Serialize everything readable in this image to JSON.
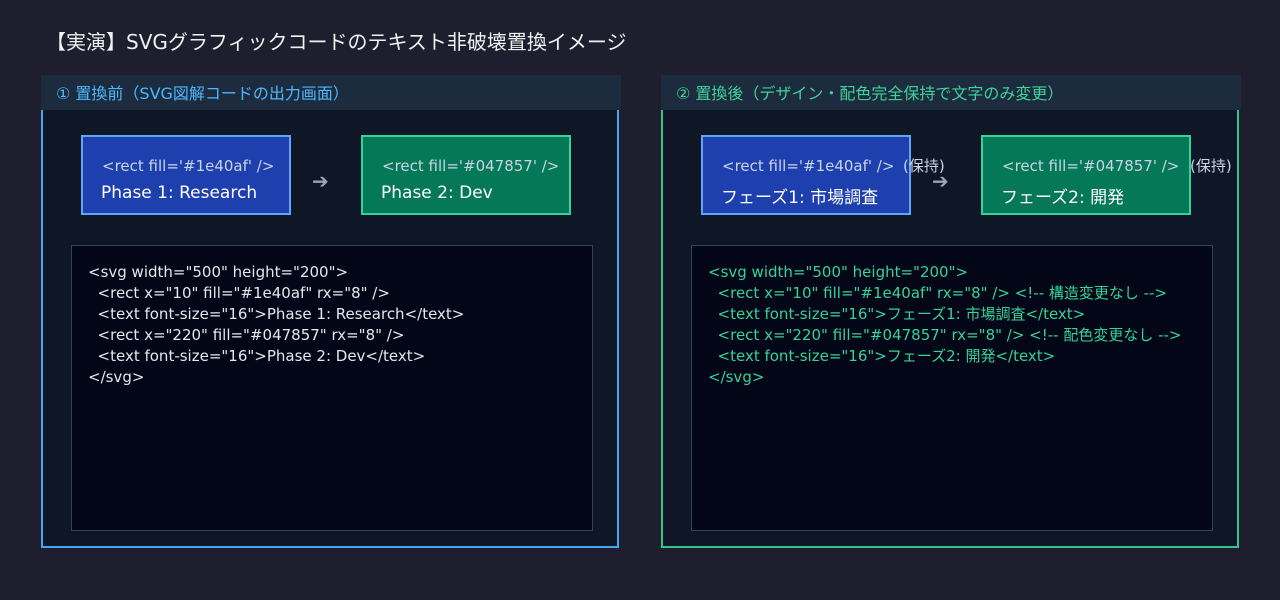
{
  "title": "【実演】SVGグラフィックコードのテキスト非破壊置換イメージ",
  "arrow_glyph": "➔",
  "before": {
    "header": "① 置換前（SVG図解コードの出力画面）",
    "node1": {
      "code": "<rect fill='#1e40af' />",
      "label": "Phase 1: Research",
      "color": "#1e40af"
    },
    "node2": {
      "code": "<rect fill='#047857' />",
      "label": "Phase 2: Dev",
      "color": "#047857"
    },
    "code_lines": [
      "<svg width=\"500\" height=\"200\">",
      "  <rect x=\"10\" fill=\"#1e40af\" rx=\"8\" />",
      "  <text font-size=\"16\">Phase 1: Research</text>",
      "  <rect x=\"220\" fill=\"#047857\" rx=\"8\" />",
      "  <text font-size=\"16\">Phase 2: Dev</text>",
      "</svg>"
    ]
  },
  "after": {
    "header": "② 置換後（デザイン・配色完全保持で文字のみ変更）",
    "node1": {
      "code": "<rect fill='#1e40af' />",
      "note": "(保持)",
      "label": "フェーズ1: 市場調査",
      "color": "#1e40af"
    },
    "node2": {
      "code": "<rect fill='#047857' />",
      "note": "(保持)",
      "label": "フェーズ2: 開発",
      "color": "#047857"
    },
    "code_lines": [
      "<svg width=\"500\" height=\"200\">",
      "  <rect x=\"10\" fill=\"#1e40af\" rx=\"8\" /> <!-- 構造変更なし -->",
      "  <text font-size=\"16\">フェーズ1: 市場調査</text>",
      "  <rect x=\"220\" fill=\"#047857\" rx=\"8\" /> <!-- 配色変更なし -->",
      "  <text font-size=\"16\">フェーズ2: 開発</text>",
      "</svg>"
    ]
  }
}
